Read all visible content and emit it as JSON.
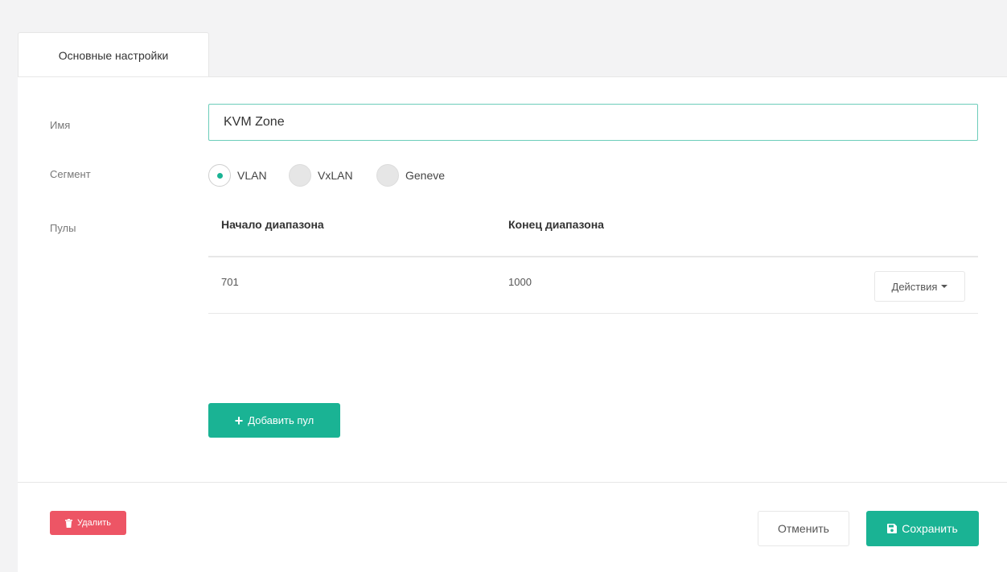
{
  "tabs": [
    {
      "label": "Основные настройки"
    }
  ],
  "form": {
    "name": {
      "label": "Имя",
      "value": "KVM Zone"
    },
    "segment": {
      "label": "Сегмент",
      "options": [
        {
          "label": "VLAN",
          "checked": true
        },
        {
          "label": "VxLAN",
          "checked": false
        },
        {
          "label": "Geneve",
          "checked": false
        }
      ]
    },
    "pools": {
      "label": "Пулы",
      "columns": [
        "Начало диапазона",
        "Конец диапазона"
      ],
      "rows": [
        {
          "start": "701",
          "end": "1000",
          "actions_label": "Действия"
        }
      ],
      "add_label": "Добавить пул"
    }
  },
  "footer": {
    "delete_label": "Удалить",
    "cancel_label": "Отменить",
    "save_label": "Сохранить"
  },
  "colors": {
    "accent": "#1ab394",
    "danger": "#ed5565",
    "focus_border": "#6ccdba"
  },
  "icons": {
    "add": "plus-icon",
    "delete": "trash-icon",
    "save": "floppy-disk-icon",
    "actions": "caret-down-icon"
  }
}
